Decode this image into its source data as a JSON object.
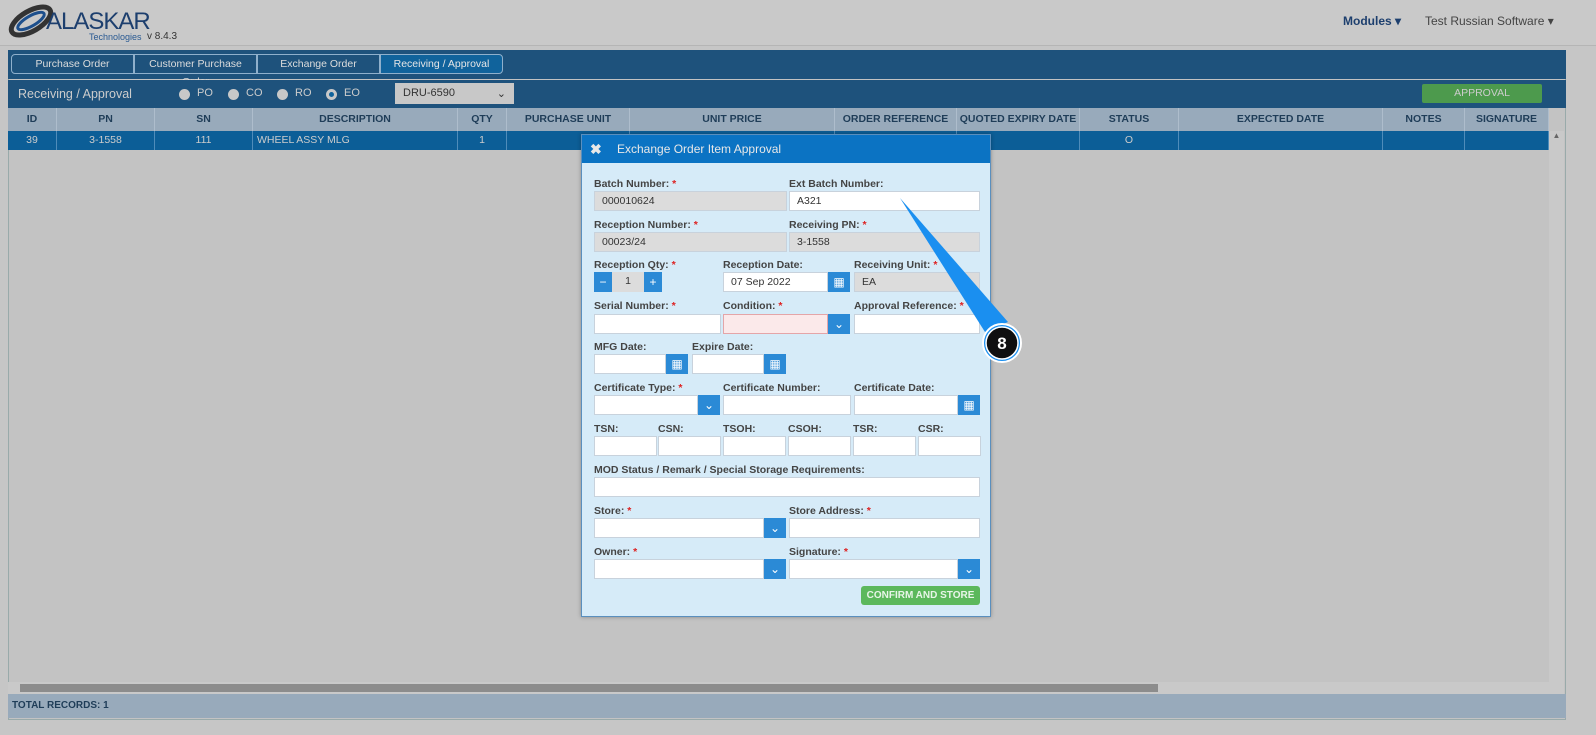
{
  "header": {
    "logo": "ALASKAR",
    "logo_sub": "Technologies",
    "version": "v 8.4.3",
    "modules": "Modules ▾",
    "user": "Test Russian Software ▾"
  },
  "tabs": [
    "Purchase Order",
    "Customer Purchase Order",
    "Exchange Order",
    "Receiving / Approval"
  ],
  "toolbar": {
    "title": "Receiving / Approval",
    "radios": [
      "PO",
      "CO",
      "RO",
      "EO"
    ],
    "selected_radio": "EO",
    "order_select": "DRU-6590",
    "approval": "APPROVAL"
  },
  "table": {
    "columns": [
      "ID",
      "PN",
      "SN",
      "DESCRIPTION",
      "QTY",
      "PURCHASE UNIT",
      "UNIT PRICE",
      "ORDER REFERENCE",
      "QUOTED EXPIRY DATE",
      "STATUS",
      "EXPECTED DATE",
      "NOTES",
      "SIGNATURE"
    ],
    "rows": [
      [
        "39",
        "3-1558",
        "111",
        "WHEEL ASSY MLG",
        "1",
        "",
        "",
        "",
        "",
        "O",
        "",
        "",
        ""
      ]
    ]
  },
  "footer": "TOTAL RECORDS: 1",
  "modal": {
    "title": "Exchange Order Item Approval",
    "labels": {
      "batch": "Batch Number:",
      "ext_batch": "Ext Batch Number:",
      "reception_number": "Reception Number:",
      "receiving_pn": "Receiving PN:",
      "reception_qty": "Reception Qty:",
      "reception_date": "Reception Date:",
      "receiving_unit": "Receiving Unit:",
      "serial": "Serial Number:",
      "condition": "Condition:",
      "approval_ref": "Approval Reference:",
      "mfg": "MFG Date:",
      "expire": "Expire Date:",
      "cert_type": "Certificate Type:",
      "cert_number": "Certificate Number:",
      "cert_date": "Certificate Date:",
      "tsn": "TSN:",
      "csn": "CSN:",
      "tsoh": "TSOH:",
      "csoh": "CSOH:",
      "tsr": "TSR:",
      "csr": "CSR:",
      "mod": "MOD Status / Remark / Special Storage Requirements:",
      "store": "Store:",
      "store_address": "Store Address:",
      "owner": "Owner:",
      "signature": "Signature:"
    },
    "values": {
      "batch": "000010624",
      "ext_batch": "A321",
      "reception_number": "00023/24",
      "receiving_pn": "3-1558",
      "reception_qty": "1",
      "reception_date": "07 Sep 2022",
      "receiving_unit": "EA"
    },
    "confirm": "CONFIRM AND STORE"
  },
  "callout": {
    "number": "8",
    "color": "#1a8ff0"
  }
}
